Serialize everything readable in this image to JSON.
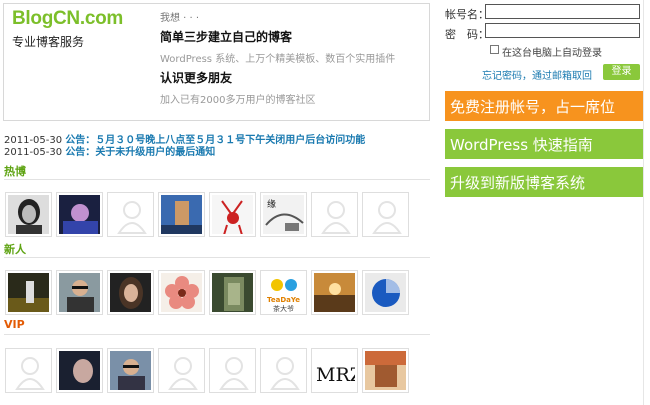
{
  "promo": {
    "logo": "BlogCN.com",
    "slogan": "专业博客服务",
    "woxiang": "我想 · · ·",
    "step1_title": "简单三步建立自己的博客",
    "step1_desc": "WordPress 系统、上万个精美模板、数百个实用插件",
    "step2_title": "认识更多朋友",
    "step2_desc": "加入已有2000多万用户的博客社区"
  },
  "news": [
    {
      "date": "2011-05-30",
      "tag": "公告：",
      "title": "５月３０号晚上八点至５月３１号下午关闭用户后台访问功能"
    },
    {
      "date": "2011-05-30",
      "tag": "公告：",
      "title": "关于未升级用户的最后通知"
    }
  ],
  "sections": {
    "hot": "热博",
    "new": "新人",
    "vip": "VIP"
  },
  "login": {
    "username_label": "帐号名：",
    "password_label": "密　码：",
    "username_value": "",
    "password_value": "",
    "auto_login_label": "在这台电脑上自动登录",
    "forgot_link": "忘记密码，通过邮箱取回",
    "login_button": "登录"
  },
  "actions": [
    {
      "label": "免费注册帐号，占一席位",
      "color": "#f7931e"
    },
    {
      "label": "WordPress 快速指南",
      "color": "#8ac83b"
    },
    {
      "label": "升级到新版博客系统",
      "color": "#8ac83b"
    }
  ],
  "avatars": {
    "hot": [
      "photo",
      "photo",
      "placeholder",
      "photo",
      "photo",
      "photo",
      "placeholder",
      "placeholder"
    ],
    "new": [
      "photo",
      "photo",
      "photo",
      "photo",
      "photo",
      "photo",
      "photo",
      "photo"
    ],
    "vip": [
      "placeholder",
      "photo",
      "photo",
      "placeholder",
      "placeholder",
      "placeholder",
      "photo",
      "photo"
    ]
  },
  "new_row_logo_text": {
    "line1": "TeaDaYe",
    "line2": "茶大爷"
  },
  "vip_row_art_text": "MRZ"
}
